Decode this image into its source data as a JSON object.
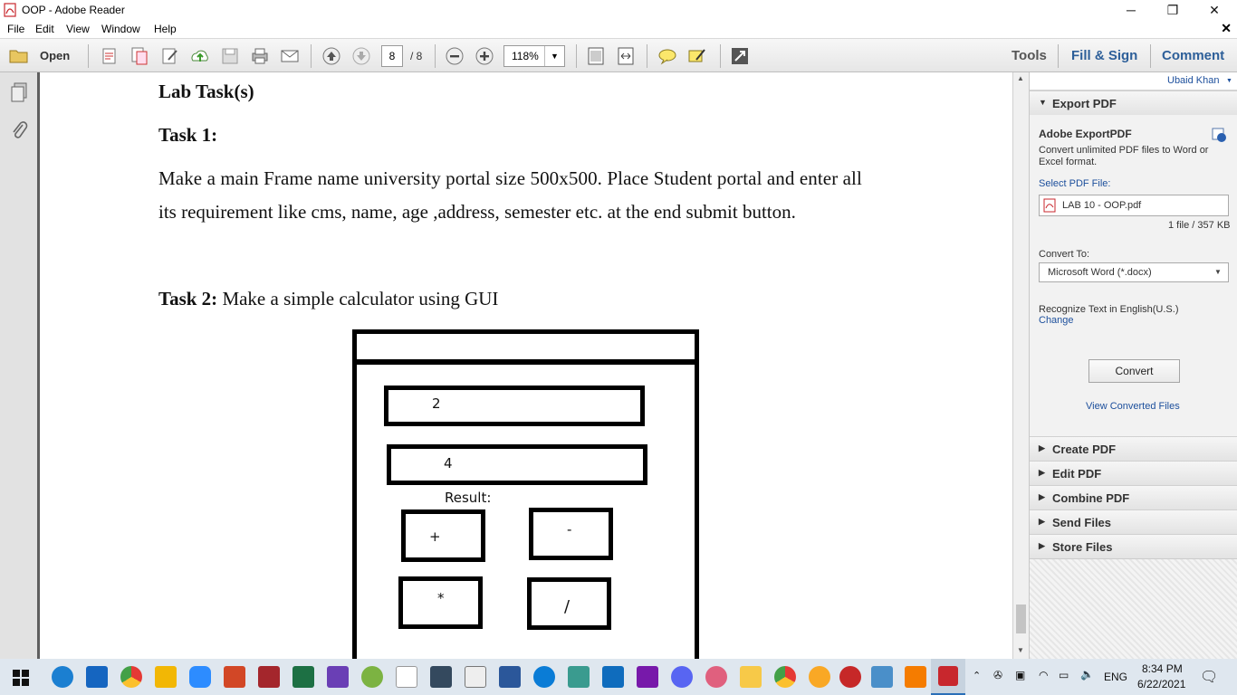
{
  "window": {
    "title": "OOP - Adobe Reader",
    "minimize": "─",
    "restore": "❐",
    "close": "✕"
  },
  "menu": {
    "items": [
      "File",
      "Edit",
      "View",
      "Window",
      "Help"
    ],
    "close_doc": "✕"
  },
  "toolbar": {
    "open_label": "Open",
    "page_current": "8",
    "page_total": "/ 8",
    "zoom": "118%",
    "tools_label": "Tools",
    "fill_sign_label": "Fill & Sign",
    "comment_label": "Comment"
  },
  "document": {
    "lab_heading": "Lab Task(s)",
    "task1_heading": "Task 1:",
    "task1_line1": "Make a main Frame name university portal size 500x500. Place Student portal and enter all",
    "task1_line2": "its requirement like cms, name, age ,address, semester etc. at the end submit button.",
    "task2_heading": "Task 2:",
    "task2_text": " Make a simple calculator using GUI",
    "calc": {
      "field1_value": "2",
      "field2_value": "4",
      "result_label": "Result:",
      "btn_plus": "+",
      "btn_minus": "-",
      "btn_multiply": "*",
      "btn_divide": "/"
    }
  },
  "panel": {
    "user": "Ubaid Khan",
    "export_pdf": "Export PDF",
    "adobe_exportpdf": "Adobe ExportPDF",
    "description": "Convert unlimited PDF files to Word or Excel format.",
    "select_pdf_label": "Select PDF File:",
    "selected_file": "LAB 10 - OOP.pdf",
    "file_info": "1 file / 357 KB",
    "convert_to_label": "Convert To:",
    "convert_to_value": "Microsoft Word (*.docx)",
    "recognize_text": "Recognize Text in English(U.S.)",
    "change_link": "Change",
    "convert_button": "Convert",
    "view_converted": "View Converted Files",
    "sections": [
      "Create PDF",
      "Edit PDF",
      "Combine PDF",
      "Send Files",
      "Store Files"
    ]
  },
  "taskbar": {
    "language": "ENG",
    "time": "8:34 PM",
    "date": "6/22/2021"
  },
  "colors": {
    "link_blue": "#1c4f9c",
    "panel_bg": "#f2f2f2",
    "taskbar_bg": "#dfe7ef"
  }
}
